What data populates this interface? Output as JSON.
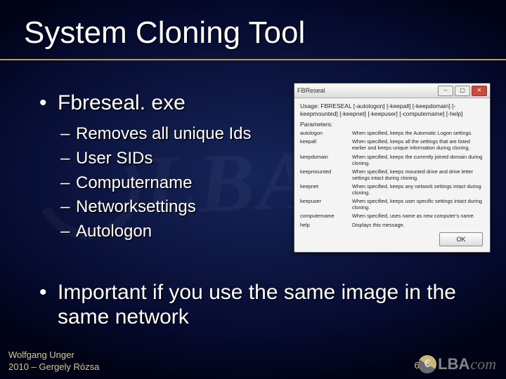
{
  "title": "System Cloning Tool",
  "bullets": {
    "top1": "Fbreseal. exe",
    "subs": [
      "Removes all unique Ids",
      "User SIDs",
      "Computername",
      "Networksettings",
      "Autologon"
    ],
    "important": "Important if you use the same image in the same network"
  },
  "footer": {
    "line1": "Wolfgang Unger",
    "line2": "2010 – Gergely Rózsa"
  },
  "page_number": "60",
  "dialog": {
    "window_title": "FBReseal",
    "usage": "Usage: FBRESEAL [-autologon] [-keepall] [-keepdomain] [-keepmounted] [-keepnet] [-keepuser] [-computername] [-help]",
    "params_label": "Parameters:",
    "params": [
      {
        "k": "autologon",
        "v": "When specified, keeps the Automatic Logon settings."
      },
      {
        "k": "keepall",
        "v": "When specified, keeps all the settings that are listed earlier and keeps unique information during cloning."
      },
      {
        "k": "keepdomain",
        "v": "When specified, keeps the currently joined domain during cloning."
      },
      {
        "k": "keepmounted",
        "v": "When specified, keeps mounted drive and drive letter settings intact during cloning."
      },
      {
        "k": "keepnet",
        "v": "When specified, keeps any network settings intact during cloning."
      },
      {
        "k": "keepuser",
        "v": "When specified, keeps user specific settings intact during cloning."
      },
      {
        "k": "computername",
        "v": "When specified, uses name as new computer's name."
      },
      {
        "k": "help",
        "v": "Displays this message."
      }
    ],
    "ok_label": "OK"
  },
  "logo": {
    "text1": "LBA",
    "text2": "com"
  },
  "watermark": "LBAcom"
}
